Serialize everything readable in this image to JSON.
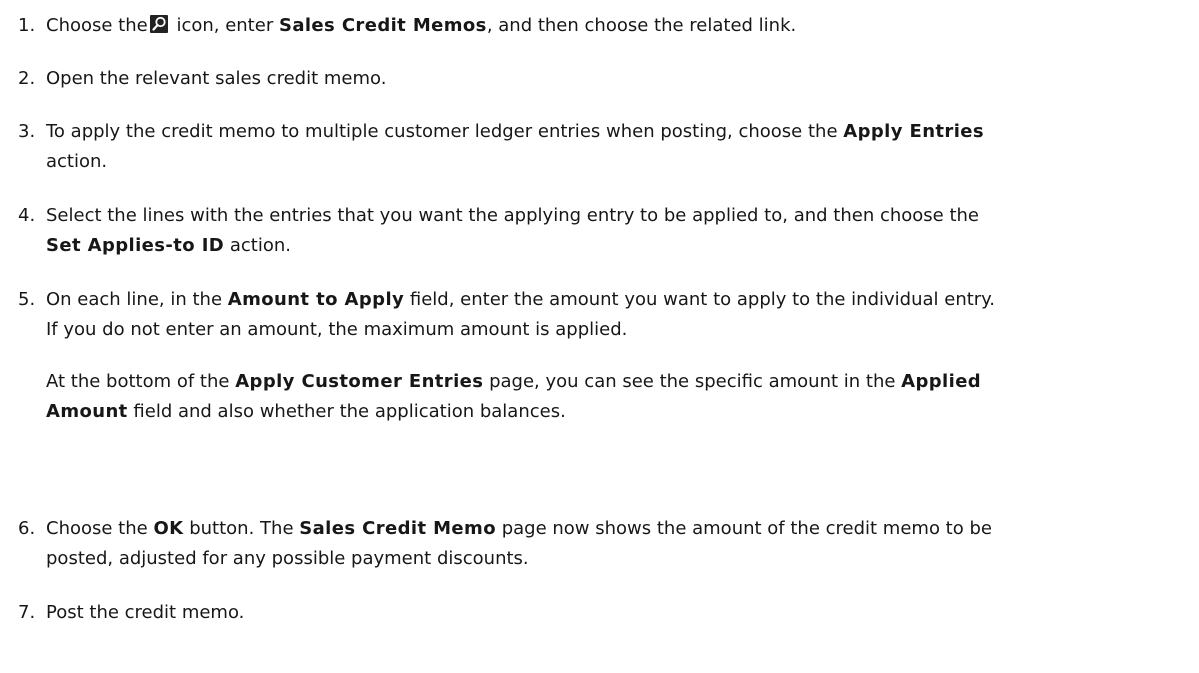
{
  "steps": [
    {
      "number": "1.",
      "t1": "Choose the",
      "icon": "search-icon",
      "t2": " icon, enter ",
      "k1": "Sales Credit Memos",
      "t3": ", and then choose the related link."
    },
    {
      "number": "2.",
      "t1": "Open the relevant sales credit memo."
    },
    {
      "number": "3.",
      "t1": "To apply the credit memo to multiple customer ledger entries when posting, choose the ",
      "k1": "Apply Entries",
      "t2": "action."
    },
    {
      "number": "4.",
      "t1": "Select the lines with the entries that you want the applying entry to be applied to, and then choose the",
      "k1": "Set Applies-to ID",
      "t2": " action."
    },
    {
      "number": "5.",
      "t1": "On each line, in the ",
      "k1": "Amount to Apply",
      "t2": " field, enter the amount you want to apply to the individual entry.",
      "t3": "If you do not enter an amount, the maximum amount is applied.",
      "p1": "At the bottom of the ",
      "pk1": "Apply Customer Entries",
      "p2": " page, you can see the specific amount in the ",
      "pk2a": "Applied",
      "pk2b": "Amount",
      "p3": " field and also whether the application balances."
    },
    {
      "number": "6.",
      "t1": "Choose the ",
      "k1": "OK",
      "t2": " button. The ",
      "k2": "Sales Credit Memo",
      "t3": " page now shows the amount of the credit memo to be",
      "t4": "posted, adjusted for any possible payment discounts."
    },
    {
      "number": "7.",
      "t1": "Post the credit memo."
    }
  ]
}
